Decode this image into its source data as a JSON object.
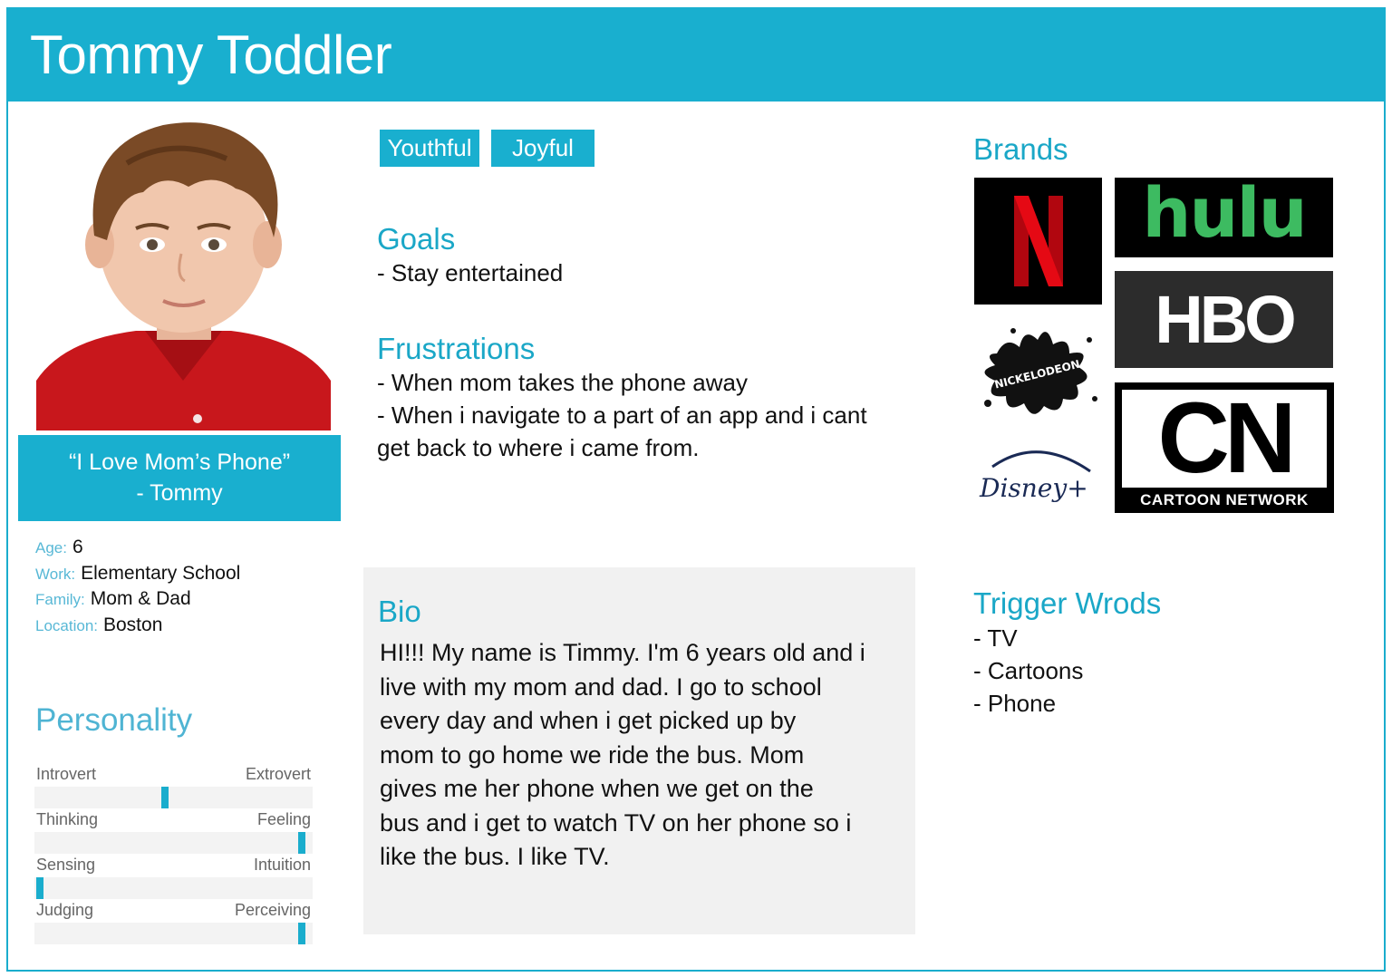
{
  "persona": {
    "name": "Tommy Toddler",
    "quote": "“I Love Mom’s Phone”",
    "quote_author": "- Tommy",
    "info": [
      {
        "key": "Age:",
        "value": "6"
      },
      {
        "key": "Work:",
        "value": "Elementary School"
      },
      {
        "key": "Family:",
        "value": "Mom & Dad"
      },
      {
        "key": "Location:",
        "value": "Boston"
      }
    ]
  },
  "personality": {
    "title": "Personality",
    "traits": [
      {
        "left": "Introvert",
        "right": "Extrovert",
        "level": 0.47
      },
      {
        "left": "Thinking",
        "right": "Feeling",
        "level": 0.96
      },
      {
        "left": "Sensing",
        "right": "Intuition",
        "level": 0.02
      },
      {
        "left": "Judging",
        "right": "Perceiving",
        "level": 0.96
      }
    ]
  },
  "tags": [
    "Youthful",
    "Joyful"
  ],
  "goals": {
    "title": "Goals",
    "items": [
      "- Stay entertained"
    ]
  },
  "frustrations": {
    "title": "Frustrations",
    "items": [
      "- When mom takes the phone away",
      "- When i navigate to a part of an app and i cant",
      "get back to where i came from."
    ]
  },
  "bio": {
    "title": "Bio",
    "lines": [
      "HI!!! My name is Timmy. I'm 6 years old and i",
      "live with my mom and dad. I go to school",
      "every day and when i get picked up by",
      "mom to go home we ride the bus. Mom",
      "gives me her phone when we get on the",
      "bus and i get to watch TV on her phone so i",
      "like the bus. I like TV."
    ]
  },
  "brands": {
    "title": "Brands",
    "logos": {
      "netflix": "N",
      "hulu": "hulu",
      "hbo": "HBO",
      "nickelodeon": "NICKELODEON",
      "disney": "Disney+",
      "cn_mark": "CN",
      "cn_text": "CARTOON NETWORK"
    }
  },
  "trigger_words": {
    "title": "Trigger Wrods",
    "items": [
      "- TV",
      "- Cartoons",
      "- Phone"
    ]
  },
  "colors": {
    "accent": "#19afcf",
    "netflix_red": "#e50914",
    "hulu_green": "#3dbb61"
  }
}
